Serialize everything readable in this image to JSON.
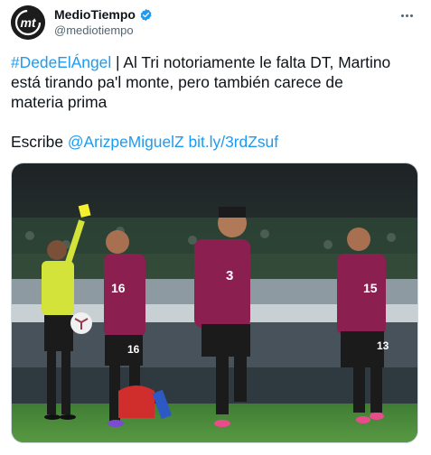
{
  "header": {
    "display_name": "MedioTiempo",
    "handle": "@mediotiempo",
    "avatar_text": "mt",
    "verified_icon": "verified-badge-icon",
    "more_icon": "more-options-icon"
  },
  "tweet": {
    "hashtag": "#DedeElÁngel",
    "line1_rest": " | Al Tri notoriamente le falta DT, Martino",
    "line2": "está tirando pa'l monte, pero también carece de",
    "line3": "materia prima",
    "line5_prefix": "Escribe ",
    "mention": "@ArizpeMiguelZ",
    "link": "bit.ly/3rdZsuf"
  },
  "media": {
    "description_icon": "match-photo",
    "jersey_numbers": [
      "16",
      "3",
      "15",
      "16",
      "13"
    ]
  },
  "colors": {
    "link": "#1d9bf0",
    "text": "#0f1419",
    "muted": "#536471",
    "jersey": "#8b1f4f",
    "referee": "#d4e33a",
    "pitch": "#4f8a3a"
  }
}
